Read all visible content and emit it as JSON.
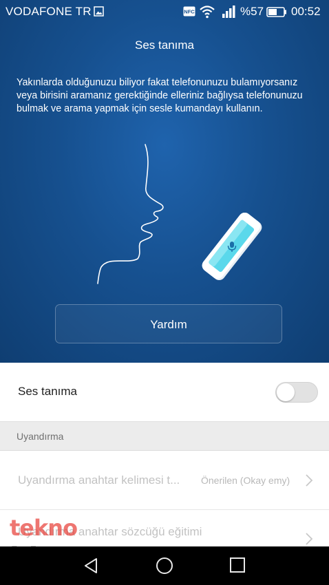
{
  "status_bar": {
    "carrier": "VODAFONE TR",
    "nfc": "NFC",
    "battery_percent": "%57",
    "time": "00:52",
    "icons": [
      "image-notification-icon",
      "nfc-icon",
      "wifi-icon",
      "signal-icon",
      "battery-icon"
    ]
  },
  "header": {
    "title": "Ses tanıma",
    "description": "Yakınlarda olduğunuzu biliyor fakat telefonunuzu bulamıyorsanız veya birisini aramanız gerektiğinde elleriniz bağlıysa telefonunuzu bulmak ve arama yapmak için sesle kumandayı kullanın."
  },
  "help_button": {
    "label": "Yardım"
  },
  "settings": {
    "voice_recognition": {
      "label": "Ses tanıma",
      "enabled": false
    },
    "wake_section": {
      "label": "Uyandırma"
    },
    "wake_keyword": {
      "label": "Uyandırma anahtar kelimesi t...",
      "value": "Önerilen (Okay emy)"
    },
    "keyword_training": {
      "label": "Uyandırma anahtar sözcüğü eğitimi"
    }
  },
  "watermark": {
    "line1": "tekno",
    "line2": "blog"
  },
  "nav_bar": {
    "icons": [
      "back-icon",
      "home-icon",
      "recent-apps-icon"
    ]
  },
  "colors": {
    "hero_blue": "#16508f",
    "toggle_off": "#e2e2e2",
    "accent_cyan": "#4fd6e8",
    "watermark_red": "#e8413a"
  }
}
